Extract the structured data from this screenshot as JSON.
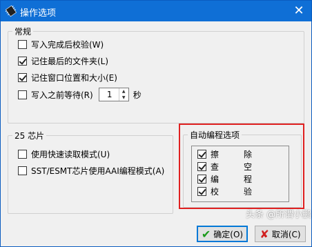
{
  "window": {
    "title": "操作选项",
    "close_glyph": "✕"
  },
  "general": {
    "legend": "常规",
    "options": [
      {
        "label": "写入完成后校验(W)",
        "checked": false
      },
      {
        "label": "记住最后的文件夹(L)",
        "checked": true
      },
      {
        "label": "记住窗口位置和大小(E)",
        "checked": true
      },
      {
        "label": "写入之前等待(R)",
        "checked": false
      }
    ],
    "wait_value": "1",
    "wait_unit": "秒"
  },
  "chip25": {
    "legend": "25 芯片",
    "options": [
      {
        "label": "使用快速读取模式(U)",
        "checked": false
      },
      {
        "label": "SST/ESMT芯片使用AAI编程模式(A)",
        "checked": false
      }
    ]
  },
  "auto_program": {
    "legend": "自动编程选项",
    "items": [
      {
        "c1": "擦",
        "c2": "除",
        "checked": true
      },
      {
        "c1": "查",
        "c2": "空",
        "checked": true
      },
      {
        "c1": "编",
        "c2": "程",
        "checked": true
      },
      {
        "c1": "校",
        "c2": "验",
        "checked": true
      }
    ]
  },
  "buttons": {
    "ok": "确定(O)",
    "cancel": "取消(C)"
  },
  "watermark": "头条 @所谓小鹏",
  "icons": {
    "app": "chip-icon",
    "ok": "check-icon",
    "cancel": "x-icon"
  }
}
